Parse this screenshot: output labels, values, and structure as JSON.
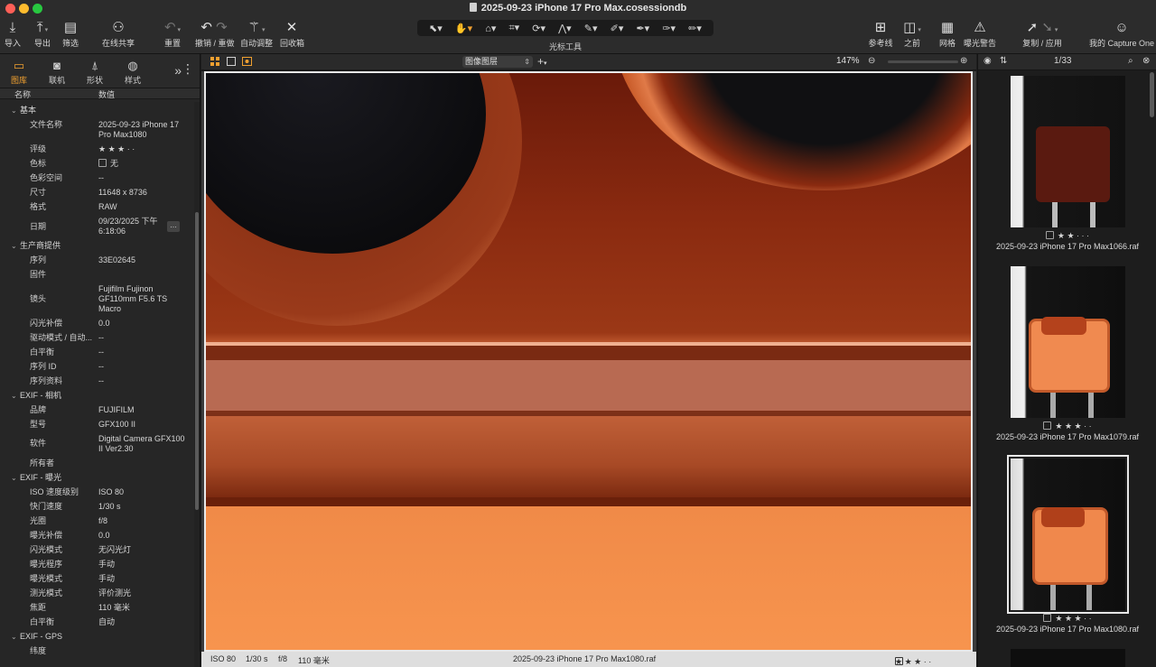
{
  "window": {
    "title": "2025-09-23 iPhone 17 Pro Max.cosessiondb"
  },
  "toolbar": {
    "import": "导入",
    "export": "导出",
    "filter": "筛选",
    "share": "在线共享",
    "reset": "重置",
    "undo_redo": "撤销 / 重做",
    "auto_adjust": "自动调整",
    "recycle": "回收箱",
    "cursor_tools": "光标工具",
    "reference": "参考线",
    "before": "之前",
    "grid": "网格",
    "exposure_warning": "曝光警告",
    "copy_apply": "复制 / 应用",
    "my_capture_one": "我的 Capture One"
  },
  "tool_tabs": [
    {
      "label": "图库",
      "icon": "folder-icon"
    },
    {
      "label": "联机",
      "icon": "camera-icon"
    },
    {
      "label": "形状",
      "icon": "shape-icon"
    },
    {
      "label": "样式",
      "icon": "style-icon"
    }
  ],
  "metadata": {
    "col_name": "名称",
    "col_value": "数值",
    "basic": {
      "title": "基本",
      "filename_k": "文件名称",
      "filename_v": "2025-09-23 iPhone 17 Pro Max1080",
      "rating_k": "评级",
      "rating_v": "★ ★ ★ · ·",
      "color_k": "色标",
      "color_v": "无",
      "colorspace_k": "色彩空间",
      "colorspace_v": "--",
      "size_k": "尺寸",
      "size_v": "11648 x 8736",
      "format_k": "格式",
      "format_v": "RAW",
      "date_k": "日期",
      "date_v": "09/23/2025 下午 6:18:06"
    },
    "vendor": {
      "title": "生产商提供",
      "serial_k": "序列",
      "serial_v": "33E02645",
      "firmware_k": "固件",
      "firmware_v": "",
      "lens_k": "镜头",
      "lens_v": "Fujifilm Fujinon GF110mm F5.6 TS Macro",
      "flash_k": "闪光补偿",
      "flash_v": "0.0",
      "drive_k": "驱动模式 / 自动...",
      "drive_v": "--",
      "wb_k": "白平衡",
      "wb_v": "--",
      "seqid_k": "序列 ID",
      "seqid_v": "--",
      "seqinfo_k": "序列资料",
      "seqinfo_v": "--"
    },
    "camera": {
      "title": "EXIF - 相机",
      "make_k": "品牌",
      "make_v": "FUJIFILM",
      "model_k": "型号",
      "model_v": "GFX100 II",
      "software_k": "软件",
      "software_v": "Digital Camera GFX100 II Ver2.30",
      "owner_k": "所有者",
      "owner_v": ""
    },
    "exposure": {
      "title": "EXIF - 曝光",
      "iso_k": "ISO 速度级别",
      "iso_v": "ISO 80",
      "shutter_k": "快门速度",
      "shutter_v": "1/30 s",
      "aperture_k": "光圈",
      "aperture_v": "f/8",
      "expcomp_k": "曝光补偿",
      "expcomp_v": "0.0",
      "flashmode_k": "闪光模式",
      "flashmode_v": "无闪光灯",
      "program_k": "曝光程序",
      "program_v": "手动",
      "expmode_k": "曝光模式",
      "expmode_v": "手动",
      "metering_k": "测光模式",
      "metering_v": "评价测光",
      "focal_k": "焦距",
      "focal_v": "110 毫米",
      "wb_k": "白平衡",
      "wb_v": "自动"
    },
    "gps": {
      "title": "EXIF - GPS",
      "lat_k": "纬度",
      "lat_v": ""
    }
  },
  "viewer": {
    "layer": "图像图层",
    "zoom": "147%",
    "zoom_level": 0.32,
    "status": {
      "iso": "ISO 80",
      "shutter": "1/30 s",
      "aperture": "f/8",
      "focal": "110 毫米",
      "filename": "2025-09-23 iPhone 17 Pro Max1080.raf",
      "rating": "★ ★ ★ · ·"
    }
  },
  "browser": {
    "counter": "1/33",
    "items": [
      {
        "name": "2025-09-23 iPhone 17 Pro Max1066.raf",
        "rating": "★ ★ · · ·"
      },
      {
        "name": "2025-09-23 iPhone 17 Pro Max1079.raf",
        "rating": "★ ★ ★ · ·"
      },
      {
        "name": "2025-09-23 iPhone 17 Pro Max1080.raf",
        "rating": "★ ★ ★ · ·"
      }
    ]
  },
  "colors": {
    "accent": "#f0a030",
    "photo_orange": "#f7944e"
  }
}
